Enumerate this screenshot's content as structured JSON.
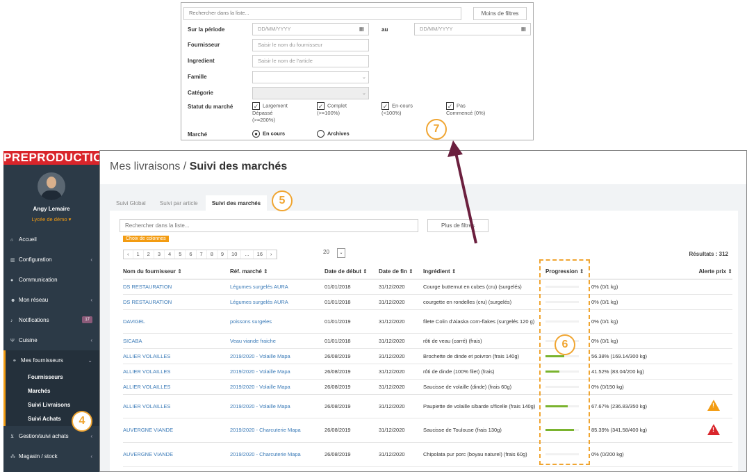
{
  "sidebar": {
    "env": "PREPRODUCTION",
    "user": "Angy Lemaire",
    "school": "Lycée de démo ▾",
    "items": [
      {
        "label": "Accueil",
        "icon": "home-icon",
        "glyph": "⌂"
      },
      {
        "label": "Configuration",
        "icon": "bank-icon",
        "glyph": "▥",
        "arrow": "‹"
      },
      {
        "label": "Communication",
        "icon": "chat-icon",
        "glyph": "●"
      },
      {
        "label": "Mon réseau",
        "icon": "users-icon",
        "glyph": "☻",
        "arrow": "‹"
      },
      {
        "label": "Notifications",
        "icon": "bell-icon",
        "glyph": "♪",
        "badge": "17"
      },
      {
        "label": "Cuisine",
        "icon": "fork-icon",
        "glyph": "Ψ",
        "arrow": "‹"
      },
      {
        "label": "Mes fournisseurs",
        "icon": "handshake-icon",
        "glyph": "⚭",
        "arrow": "⌄"
      }
    ],
    "subitems": [
      "Fournisseurs",
      "Marchés",
      "Suivi Livraisons",
      "Suivi Achats"
    ],
    "bottom": [
      {
        "label": "Gestion/suivi achats",
        "icon": "cart-icon",
        "glyph": "⊻",
        "arrow": "‹"
      },
      {
        "label": "Magasin / stock",
        "icon": "cubes-icon",
        "glyph": "⁂",
        "arrow": "‹"
      }
    ]
  },
  "header": {
    "section": "Mes livraisons / ",
    "title": "Suivi des marchés"
  },
  "tabs": [
    "Suivi Global",
    "Suivi par article",
    "Suivi des marchés"
  ],
  "search": {
    "placeholder": "Rechercher dans la liste..."
  },
  "more_filters": "Plus de filtres",
  "choose_cols": "Choix de colonnes",
  "pager": [
    "‹",
    "1",
    "2",
    "3",
    "4",
    "5",
    "6",
    "7",
    "8",
    "9",
    "10",
    "...",
    "16",
    "›"
  ],
  "page_size": "20",
  "results": "Résultats : 312",
  "columns": [
    "Nom du fournisseur ⇕",
    "Réf. marché ⇕",
    "Date de début ⇕",
    "Date de fin ⇕",
    "Ingrédient ⇕",
    "Progression ⇕",
    "",
    "Alerte prix ⇕"
  ],
  "rows": [
    {
      "f": "DS RESTAURATION",
      "m": "Légumes surgelés AURA",
      "d": "01/01/2018",
      "e": "31/12/2020",
      "i": "Courge butternut en cubes (cru) (surgelés)",
      "p": 0,
      "t": "0% (0/1 kg)",
      "a": ""
    },
    {
      "f": "DS RESTAURATION",
      "m": "Légumes surgelés AURA",
      "d": "01/01/2018",
      "e": "31/12/2020",
      "i": "courgette en rondelles (cru) (surgelés)",
      "p": 0,
      "t": "0% (0/1 kg)",
      "a": ""
    },
    {
      "f": "DAVIGEL",
      "m": "poissons surgeles",
      "d": "01/01/2019",
      "e": "31/12/2020",
      "i": "filete Colin d'Alaska corn-flakes (surgelés 120 g)",
      "p": 0,
      "t": "0% (0/1 kg)",
      "a": ""
    },
    {
      "f": "SICABA",
      "m": "Veau viande fraiche",
      "d": "01/01/2018",
      "e": "31/12/2020",
      "i": "rôti de veau (carré) (frais)",
      "p": 0,
      "t": "0% (0/1 kg)",
      "a": ""
    },
    {
      "f": "ALLIER VOLAILLES",
      "m": "2019/2020 - Volaille Mapa",
      "d": "26/08/2019",
      "e": "31/12/2020",
      "i": "Brochette de dinde et poivron (frais 140g)",
      "p": 56.38,
      "t": "56.38% (169.14/300 kg)",
      "a": ""
    },
    {
      "f": "ALLIER VOLAILLES",
      "m": "2019/2020 - Volaille Mapa",
      "d": "26/08/2019",
      "e": "31/12/2020",
      "i": "rôti de dinde (100% filet) (frais)",
      "p": 41.52,
      "t": "41.52% (83.04/200 kg)",
      "a": ""
    },
    {
      "f": "ALLIER VOLAILLES",
      "m": "2019/2020 - Volaille Mapa",
      "d": "26/08/2019",
      "e": "31/12/2020",
      "i": "Saucisse de volaille (dinde) (frais 60g)",
      "p": 0,
      "t": "0% (0/150 kg)",
      "a": ""
    },
    {
      "f": "ALLIER VOLAILLES",
      "m": "2019/2020 - Volaille Mapa",
      "d": "26/08/2019",
      "e": "31/12/2020",
      "i": "Paupiette de volaille s/barde s/ficelle (frais 140g)",
      "p": 67.67,
      "t": "67.67% (236.83/350 kg)",
      "a": "orange"
    },
    {
      "f": "AUVERGNE VIANDE",
      "m": "2019/2020 - Charcuterie Mapa",
      "d": "26/08/2019",
      "e": "31/12/2020",
      "i": "Saucisse de Toulouse (frais 130g)",
      "p": 85.39,
      "t": "85.39% (341.58/400 kg)",
      "a": "red"
    },
    {
      "f": "AUVERGNE VIANDE",
      "m": "2019/2020 - Charcuterie Mapa",
      "d": "26/08/2019",
      "e": "31/12/2020",
      "i": "Chipolata pur porc (boyau naturel) (frais 60g)",
      "p": 0,
      "t": "0% (0/200 kg)",
      "a": ""
    }
  ],
  "filter": {
    "search": "Rechercher dans la liste...",
    "less": "Moins de filtres",
    "period": "Sur la période",
    "date_ph": "DD/MM/YYYY",
    "au": "au",
    "supplier": "Fournisseur",
    "supplier_ph": "Saisir le nom du fournisseur",
    "ingredient": "Ingredient",
    "ingredient_ph": "Saisir le nom de l'article",
    "family": "Famille",
    "category": "Catégorie",
    "status": "Statut du marché",
    "statuses": [
      "Largement\nDépassé\n(>=200%)",
      "Complet\n(>=100%)",
      "En-cours\n(<100%)",
      "Pas\nCommencé (0%)"
    ],
    "market": "Marché",
    "opt1": "En cours",
    "opt2": "Archives"
  },
  "callouts": [
    "4",
    "5",
    "6",
    "7"
  ],
  "colors": {
    "accent": "#f39c12",
    "link": "#3a7ab7",
    "bar": "#7ab32e",
    "arrow": "#6b1f3e"
  }
}
